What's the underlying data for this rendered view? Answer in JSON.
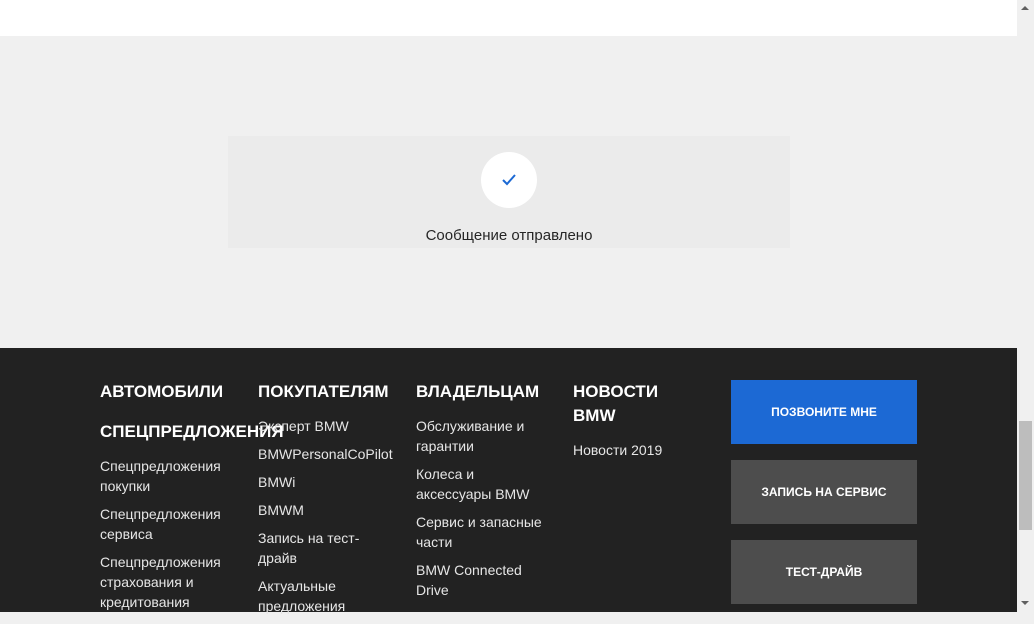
{
  "message": {
    "text": "Сообщение отправлено",
    "icon": "check-icon"
  },
  "footer": {
    "columns": [
      {
        "heading": "АВТОМОБИЛИ",
        "subheading": "СПЕЦПРЕДЛОЖЕНИЯ",
        "links": [
          "Спецпредложения покупки",
          "Спецпредложения сервиса",
          "Спецпредложения страхования и кредитования"
        ]
      },
      {
        "heading": "ПОКУПАТЕЛЯМ",
        "links": [
          "Эксперт BMW",
          "BMWPersonalCoPilot",
          "BMWi",
          "BMWM",
          "Запись на тест-драйв",
          "Актуальные предложения"
        ]
      },
      {
        "heading": "ВЛАДЕЛЬЦАМ",
        "links": [
          "Обслуживание и гарантии",
          "Колеса и аксессуары BMW",
          "Сервис и запасные части",
          "BMW Connected Drive"
        ]
      },
      {
        "heading": "НОВОСТИ BMW",
        "links": [
          "Новости 2019"
        ]
      }
    ],
    "buttons": [
      {
        "label": "ПОЗВОНИТЕ МНЕ",
        "color": "#1c69d4"
      },
      {
        "label": "ЗАПИСЬ НА СЕРВИС",
        "color": "#4d4d4d"
      },
      {
        "label": "ТЕСТ-ДРАЙВ",
        "color": "#4d4d4d"
      }
    ]
  }
}
